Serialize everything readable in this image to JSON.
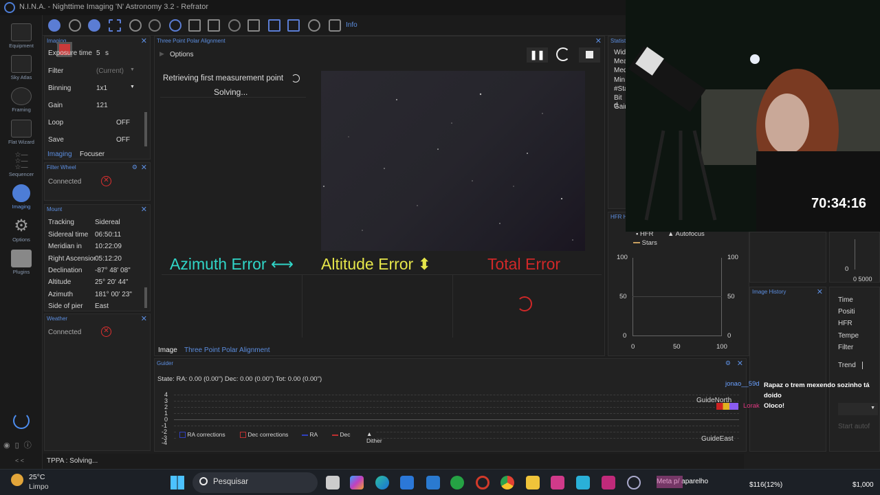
{
  "app": {
    "title": "N.I.N.A. - Nighttime Imaging 'N' Astronomy 3.2  -  Refrator"
  },
  "nav": {
    "items": [
      {
        "label": "Equipment"
      },
      {
        "label": "Sky Atlas"
      },
      {
        "label": "Framing"
      },
      {
        "label": "Flat Wizard"
      },
      {
        "label": "Sequencer"
      },
      {
        "label": "Imaging"
      },
      {
        "label": "Options"
      },
      {
        "label": "Plugins"
      }
    ],
    "collapse": "< <"
  },
  "toolbar": {
    "info_label": "Info"
  },
  "imaging_panel": {
    "title": "Imaging",
    "rows": [
      {
        "label": "Exposure time",
        "value": "5",
        "unit": "s"
      },
      {
        "label": "Filter",
        "value": "(Current)"
      },
      {
        "label": "Binning",
        "value": "1x1"
      },
      {
        "label": "Gain",
        "value": "121"
      },
      {
        "label": "Loop",
        "value": "OFF"
      },
      {
        "label": "Save",
        "value": "OFF"
      }
    ],
    "tabs": [
      "Imaging",
      "Focuser"
    ]
  },
  "filter_wheel": {
    "title": "Filter Wheel",
    "status": "Connected"
  },
  "mount": {
    "title": "Mount",
    "rows": [
      {
        "label": "Tracking",
        "value": "Sidereal"
      },
      {
        "label": "Sidereal time",
        "value": "06:50:11"
      },
      {
        "label": "Meridian in",
        "value": "10:22:09"
      },
      {
        "label": "Right Ascension",
        "value": "05:12:20"
      },
      {
        "label": "Declination",
        "value": "-87° 48' 08\""
      },
      {
        "label": "Altitude",
        "value": "25° 20' 44\""
      },
      {
        "label": "Azimuth",
        "value": "181° 00' 23\""
      },
      {
        "label": "Side of pier",
        "value": "East"
      }
    ]
  },
  "weather": {
    "title": "Weather",
    "status": "Connected"
  },
  "tppa": {
    "title": "Three Point Polar Alignment",
    "options_label": "Options",
    "status_line1": "Retrieving first measurement point",
    "status_line2": "Solving...",
    "azimuth_label": "Azimuth Error ⟷",
    "altitude_label": "Altitude Error ⬍",
    "total_label": "Total Error",
    "tabs": [
      "Image",
      "Three Point Polar Alignment"
    ],
    "colors": {
      "azimuth": "#30d6c8",
      "altitude": "#e6e64a",
      "total": "#d02828"
    }
  },
  "statistics": {
    "title": "Statist",
    "labels": [
      "Wid",
      "Mea",
      "Med",
      "Min",
      "#Sta",
      "Bit d",
      "Gain"
    ]
  },
  "hfr_panel": {
    "title": "HFR H",
    "legend": [
      "HFR",
      "Autofocus",
      "Stars"
    ],
    "y_ticks": [
      "100",
      "50",
      "0"
    ],
    "x_ticks": [
      "0",
      "50",
      "100"
    ]
  },
  "right_small_chart": {
    "y_tick": "0",
    "x_ticks": "0 5000"
  },
  "image_history": {
    "title": "Image History",
    "labels": [
      "Time",
      "Positi",
      "HFR",
      "Tempe",
      "Filter"
    ],
    "trend_label": "Trend",
    "start_label": "Start autof"
  },
  "guider": {
    "title": "Guider",
    "state_line": "State:  RA: 0.00 (0.00\")  Dec: 0.00 (0.00\")  Tot: 0.00 (0.00\")",
    "y_ticks": [
      "4",
      "3",
      "2",
      "1",
      "0",
      "-1",
      "-2",
      "-3",
      "-4"
    ],
    "north_label": "GuideNorth",
    "east_label": "GuideEast",
    "legend": [
      "RA corrections",
      "Dec corrections",
      "RA",
      "Dec",
      "Dither"
    ]
  },
  "status_bar": {
    "text": "TPPA :   Solving..."
  },
  "webcam": {
    "timer": "70:34:16"
  },
  "chat": [
    {
      "user": "jonao__59d",
      "message": "Rapaz o trem mexendo sozinho tá doido"
    },
    {
      "user": "Lorak",
      "message": "Oloco!"
    }
  ],
  "taskbar": {
    "temperature": "25°C",
    "weather": "Limpo",
    "search_placeholder": "Pesquisar",
    "notification": "Meta p/ aparelho",
    "money1": "$116(12%)",
    "money2": "$1,000"
  }
}
